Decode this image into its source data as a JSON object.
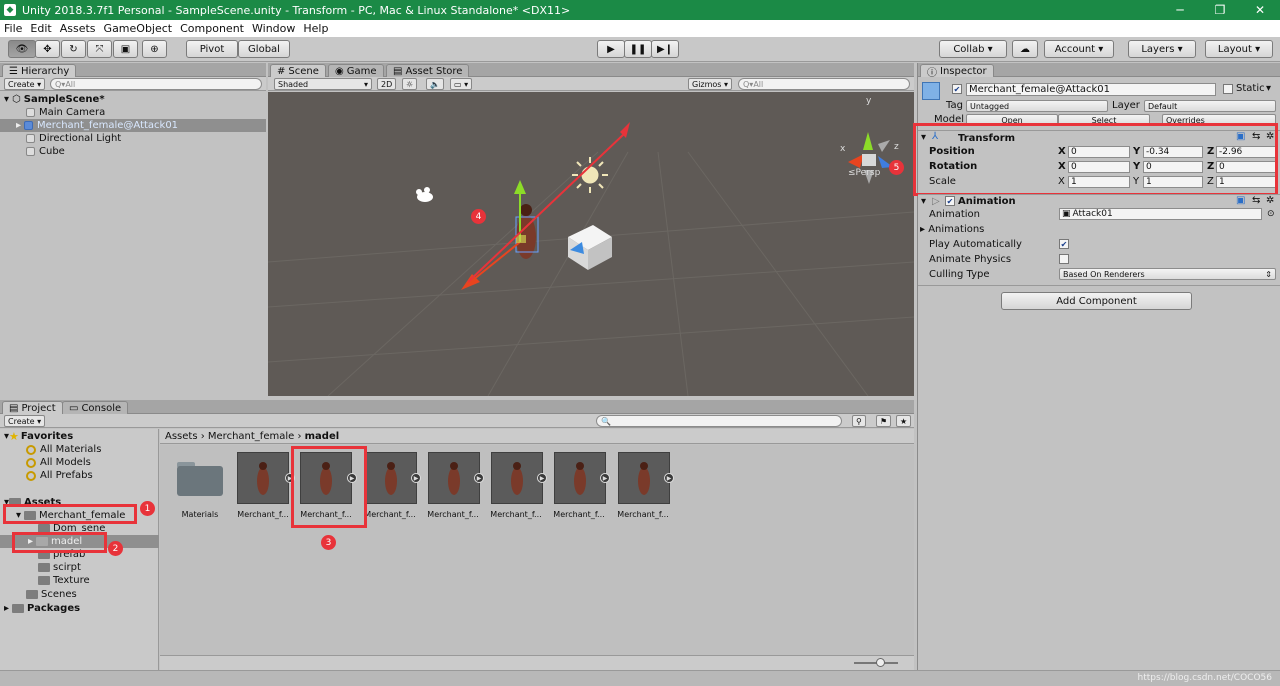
{
  "window": {
    "title": "Unity 2018.3.7f1 Personal - SampleScene.unity - Transform - PC, Mac & Linux Standalone* <DX11>",
    "minimize": "─",
    "maximize": "❐",
    "close": "✕"
  },
  "menu": [
    "File",
    "Edit",
    "Assets",
    "GameObject",
    "Component",
    "Window",
    "Help"
  ],
  "toolbar": {
    "pivot": "Pivot",
    "global": "Global",
    "collab": "Collab ▾",
    "account": "Account",
    "layers": "Layers",
    "layout": "Layout"
  },
  "hierarchy": {
    "tab": "Hierarchy",
    "create": "Create ▾",
    "search_placeholder": "Q▾All",
    "scene": "SampleScene*",
    "items": [
      "Main Camera",
      "Merchant_female@Attack01",
      "Directional Light",
      "Cube"
    ]
  },
  "scene": {
    "tabs": [
      "Scene",
      "Game",
      "Asset Store"
    ],
    "shading": "Shaded",
    "mode2d": "2D",
    "gizmos": "Gizmos ▾",
    "search_placeholder": "Q▾All",
    "persp": "≤Persp",
    "gizmo_axes": {
      "x": "x",
      "y": "y",
      "z": "z"
    },
    "annotation_4": "4",
    "annotation_5": "5"
  },
  "project": {
    "tabs": [
      "Project",
      "Console"
    ],
    "create": "Create ▾",
    "favorites_label": "Favorites",
    "favorites": [
      "All Materials",
      "All Models",
      "All Prefabs"
    ],
    "assets_label": "Assets",
    "tree": [
      "Merchant_female",
      "Dom_sene",
      "madel",
      "prefab",
      "scirpt",
      "Texture",
      "Scenes"
    ],
    "packages": "Packages",
    "breadcrumb": [
      "Assets",
      "Merchant_female",
      "madel"
    ],
    "grid_labels": [
      "Materials",
      "Merchant_f...",
      "Merchant_f...",
      "Merchant_f...",
      "Merchant_f...",
      "Merchant_f...",
      "Merchant_f...",
      "Merchant_f..."
    ],
    "annotation_1": "1",
    "annotation_2": "2",
    "annotation_3": "3"
  },
  "inspector": {
    "tab": "Inspector",
    "object_name": "Merchant_female@Attack01",
    "static": "Static",
    "tag_label": "Tag",
    "tag": "Untagged",
    "layer_label": "Layer",
    "layer": "Default",
    "model_label": "Model",
    "model_open": "Open",
    "model_select": "Select",
    "model_overrides": "Overrides",
    "transform": {
      "title": "Transform",
      "position": {
        "label": "Position",
        "x": "0",
        "y": "-0.34",
        "z": "-2.96"
      },
      "rotation": {
        "label": "Rotation",
        "x": "0",
        "y": "0",
        "z": "0"
      },
      "scale": {
        "label": "Scale",
        "x": "1",
        "y": "1",
        "z": "1"
      }
    },
    "animation": {
      "title": "Animation",
      "animation_label": "Animation",
      "animation_value": "Attack01",
      "animations_label": "Animations",
      "play_auto_label": "Play Automatically",
      "play_auto": true,
      "animate_physics_label": "Animate Physics",
      "animate_physics": false,
      "culling_label": "Culling Type",
      "culling_value": "Based On Renderers"
    },
    "add_component": "Add Component"
  },
  "watermark": "https://blog.csdn.net/COCO56",
  "colors": {
    "titlebar": "#1b8a46",
    "scene_bg": "#5f5a56",
    "annotation": "#e8333a",
    "selection": "#8f8f8f"
  }
}
